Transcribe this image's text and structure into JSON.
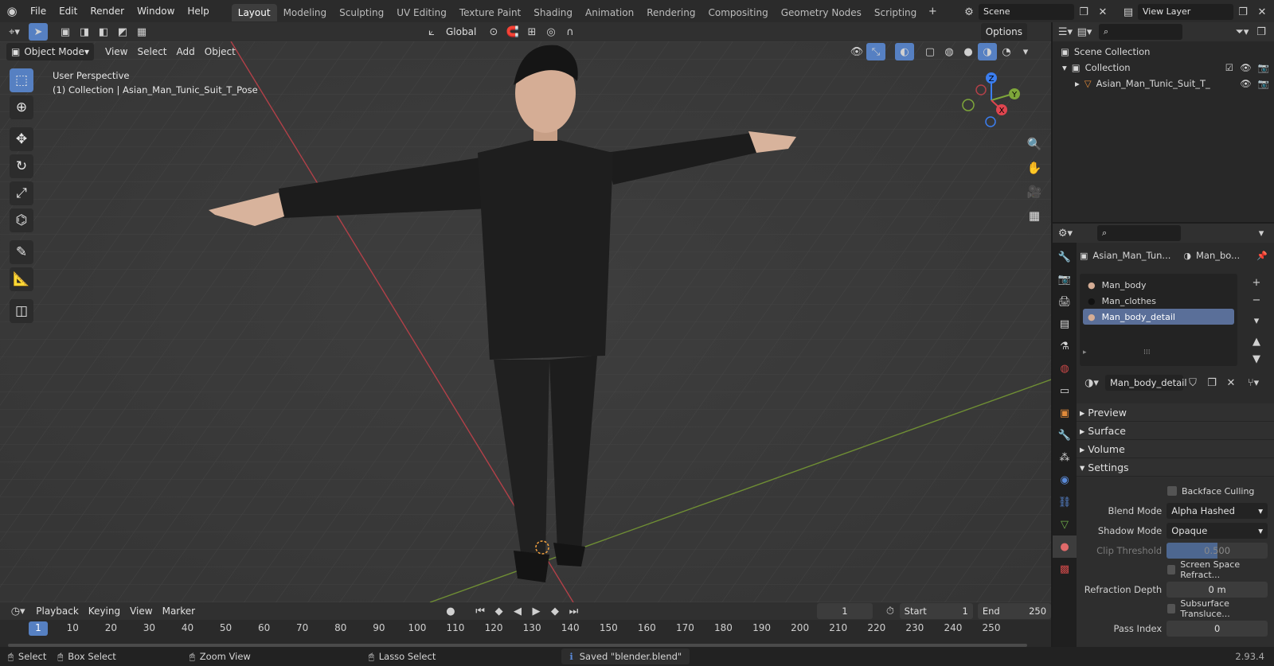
{
  "menu": {
    "items": [
      "File",
      "Edit",
      "Render",
      "Window",
      "Help"
    ]
  },
  "workspaces": {
    "tabs": [
      "Layout",
      "Modeling",
      "Sculpting",
      "UV Editing",
      "Texture Paint",
      "Shading",
      "Animation",
      "Rendering",
      "Compositing",
      "Geometry Nodes",
      "Scripting"
    ],
    "active": "Layout"
  },
  "scene": {
    "name": "Scene",
    "view_layer": "View Layer"
  },
  "viewport_header": {
    "mode": "Object Mode",
    "menus": [
      "View",
      "Select",
      "Add",
      "Object"
    ],
    "transform_orientation": "Global",
    "options_label": "Options"
  },
  "viewport": {
    "perspective_label": "User Perspective",
    "collection_label": "(1) Collection | Asian_Man_Tunic_Suit_T_Pose",
    "gizmo": {
      "z": "Z",
      "y": "Y",
      "x": "X"
    }
  },
  "outliner": {
    "rows": [
      {
        "label": "Scene Collection"
      },
      {
        "label": "Collection"
      },
      {
        "label": "Asian_Man_Tunic_Suit_T_"
      }
    ]
  },
  "properties": {
    "object_name": "Asian_Man_Tun...",
    "material_name_short": "Man_bo...",
    "material_slots": [
      "Man_body",
      "Man_clothes",
      "Man_body_detail"
    ],
    "active_material": "Man_body_detail",
    "panels": {
      "preview": "Preview",
      "surface": "Surface",
      "volume": "Volume",
      "settings": "Settings"
    },
    "settings": {
      "backface_culling": "Backface Culling",
      "blend_mode_label": "Blend Mode",
      "blend_mode_value": "Alpha Hashed",
      "shadow_mode_label": "Shadow Mode",
      "shadow_mode_value": "Opaque",
      "clip_threshold_label": "Clip Threshold",
      "clip_threshold_value": "0.500",
      "ssr": "Screen Space Refract...",
      "refraction_depth_label": "Refraction Depth",
      "refraction_depth_value": "0 m",
      "sss": "Subsurface Transluce...",
      "pass_index_label": "Pass Index",
      "pass_index_value": "0"
    }
  },
  "timeline": {
    "menus": [
      "Playback",
      "Keying",
      "View",
      "Marker"
    ],
    "current_frame": "1",
    "start_label": "Start",
    "start_value": "1",
    "end_label": "End",
    "end_value": "250",
    "ticks": [
      "1",
      "10",
      "20",
      "30",
      "40",
      "50",
      "60",
      "70",
      "80",
      "90",
      "100",
      "110",
      "120",
      "130",
      "140",
      "150",
      "160",
      "170",
      "180",
      "190",
      "200",
      "210",
      "220",
      "230",
      "240",
      "250"
    ]
  },
  "statusbar": {
    "select": "Select",
    "box_select": "Box Select",
    "zoom_view": "Zoom View",
    "lasso_select": "Lasso Select",
    "message": "Saved \"blender.blend\"",
    "version": "2.93.4"
  },
  "colors": {
    "accent": "#5680c2",
    "x_axis": "#e0454f",
    "y_axis": "#7ea63a",
    "z_axis": "#3b7ef0",
    "viewport_bg": "#3c3c3c"
  }
}
